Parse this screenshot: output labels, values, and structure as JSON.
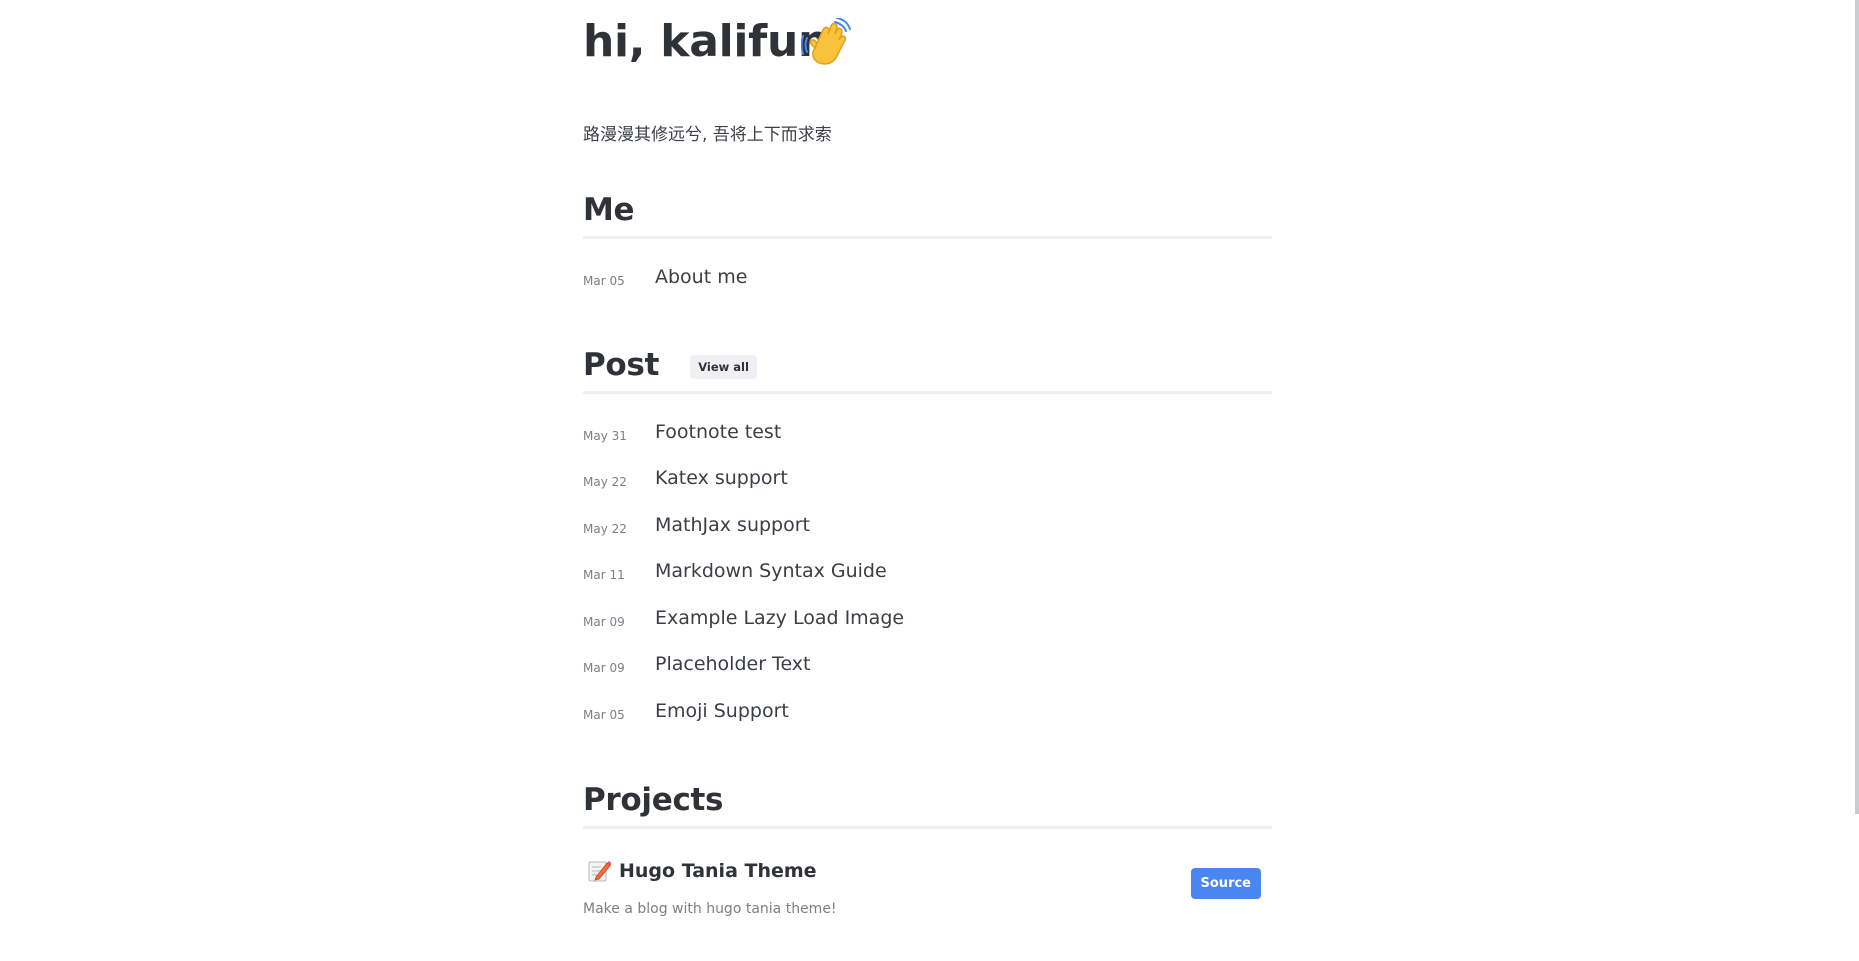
{
  "header": {
    "greeting": "hi, kalifun",
    "wave_icon": "waving-hand-icon",
    "tagline": "路漫漫其修远兮, 吾将上下而求索"
  },
  "me": {
    "title": "Me",
    "items": [
      {
        "date": "Mar 05",
        "title": "About me"
      }
    ]
  },
  "post": {
    "title": "Post",
    "view_all": "View all",
    "items": [
      {
        "date": "May 31",
        "title": "Footnote test"
      },
      {
        "date": "May 22",
        "title": "Katex support"
      },
      {
        "date": "May 22",
        "title": "MathJax support"
      },
      {
        "date": "Mar 11",
        "title": "Markdown Syntax Guide"
      },
      {
        "date": "Mar 09",
        "title": "Example Lazy Load Image"
      },
      {
        "date": "Mar 09",
        "title": "Placeholder Text"
      },
      {
        "date": "Mar 05",
        "title": "Emoji Support"
      }
    ]
  },
  "projects": {
    "title": "Projects",
    "items": [
      {
        "icon": "memo-icon",
        "title": "Hugo Tania Theme",
        "description": "Make a blog with hugo tania theme!",
        "button": "Source"
      }
    ]
  },
  "colors": {
    "accent": "#4a86f2",
    "text": "#2f3237",
    "muted": "#7b7f86",
    "divider": "#eeeff1"
  }
}
